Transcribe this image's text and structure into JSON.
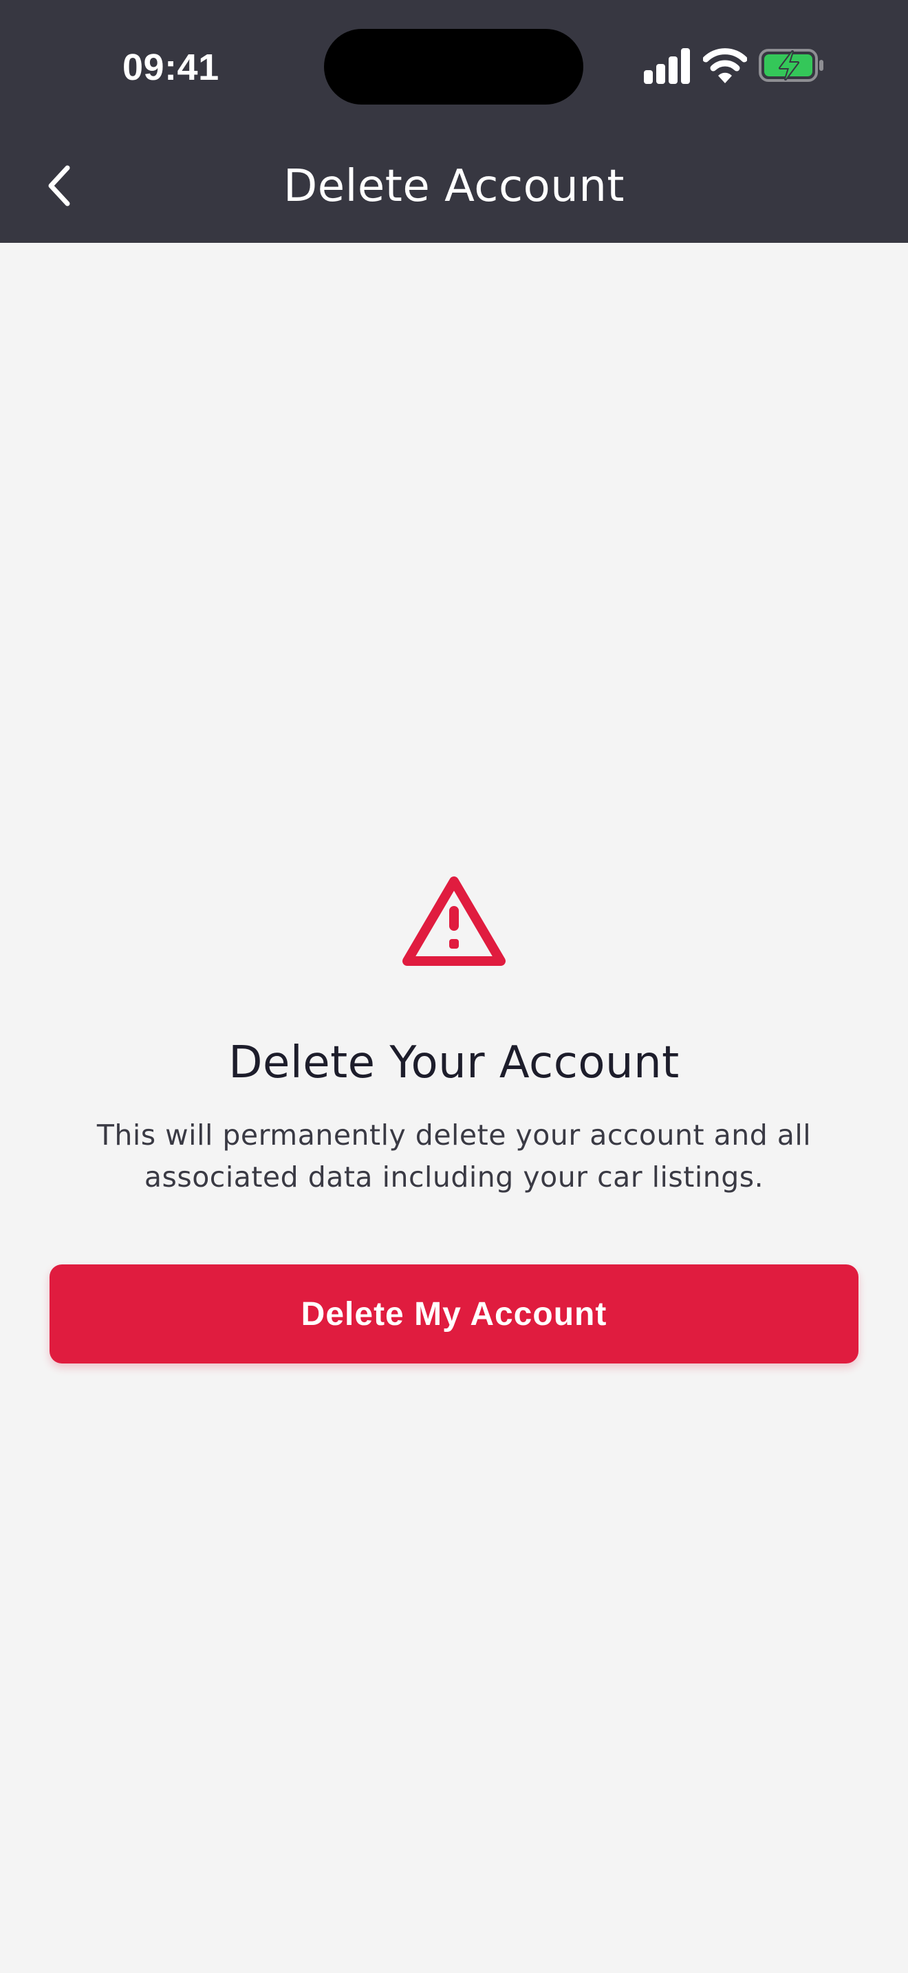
{
  "status_bar": {
    "time": "09:41",
    "icons": [
      "signal-icon",
      "wifi-icon",
      "battery-charging-icon"
    ]
  },
  "header": {
    "title": "Delete Account",
    "back_icon": "chevron-left-icon"
  },
  "content": {
    "icon": "warning-triangle-icon",
    "title": "Delete Your Account",
    "description": "This will permanently delete your account and all associated data including your car listings."
  },
  "actions": {
    "delete_label": "Delete My Account"
  },
  "colors": {
    "header_bg": "#373741",
    "page_bg": "#f4f4f4",
    "accent_red": "#e01c3f",
    "battery_green": "#34c759"
  }
}
